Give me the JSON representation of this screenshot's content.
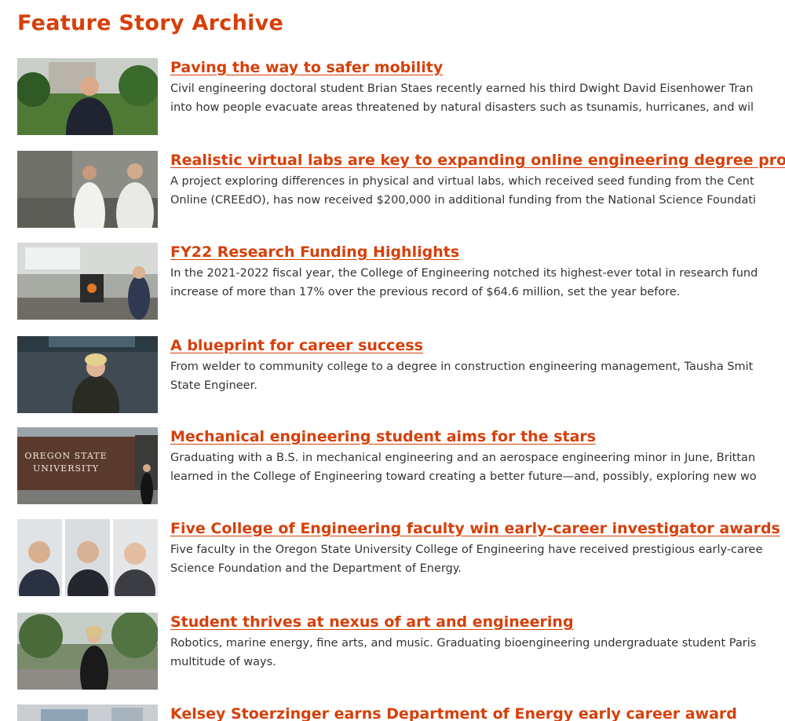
{
  "page": {
    "title": "Feature Story Archive"
  },
  "colors": {
    "accent": "#d73f09",
    "body_text": "#333333"
  },
  "stories": [
    {
      "title": "Paving the way to safer mobility",
      "summary_line1": "Civil engineering doctoral student Brian Staes recently earned his third Dwight David Eisenhower Tran",
      "summary_line2": "into how people evacuate areas threatened by natural disasters such as tsunamis, hurricanes, and wil"
    },
    {
      "title": "Realistic virtual labs are key to expanding online engineering degree prograr",
      "summary_line1": "A project exploring differences in physical and virtual labs, which received seed funding from the Cent",
      "summary_line2": "Online (CREEdO), has now received $200,000 in additional funding from the National Science Foundati"
    },
    {
      "title": "FY22 Research Funding Highlights",
      "summary_line1": "In the 2021-2022 fiscal year, the College of Engineering notched its highest-ever total in research fund",
      "summary_line2": "increase of more than 17% over the previous record of $64.6 million, set the year before."
    },
    {
      "title": "A blueprint for career success",
      "summary_line1": "From welder to community college to a degree in construction engineering management, Tausha Smit",
      "summary_line2": "State Engineer."
    },
    {
      "title": "Mechanical engineering student aims for the stars",
      "summary_line1": "Graduating with a B.S. in mechanical engineering and an aerospace engineering minor in June, Brittan",
      "summary_line2": "learned in the College of Engineering toward creating a better future—and, possibly, exploring new wo",
      "thumb_sign_line1": "OREGON STATE",
      "thumb_sign_line2": "UNIVERSITY"
    },
    {
      "title": "Five College of Engineering faculty win early-career investigator awards",
      "summary_line1": "Five faculty in the Oregon State University College of Engineering have received prestigious early-caree",
      "summary_line2": "Science Foundation and the Department of Energy."
    },
    {
      "title": "Student thrives at nexus of art and engineering",
      "summary_line1": "Robotics, marine energy, fine arts, and music. Graduating bioengineering undergraduate student Paris",
      "summary_line2": "multitude of ways."
    },
    {
      "title": "Kelsey Stoerzinger earns Department of Energy early career award",
      "summary_line1": "",
      "summary_line2": ""
    }
  ]
}
